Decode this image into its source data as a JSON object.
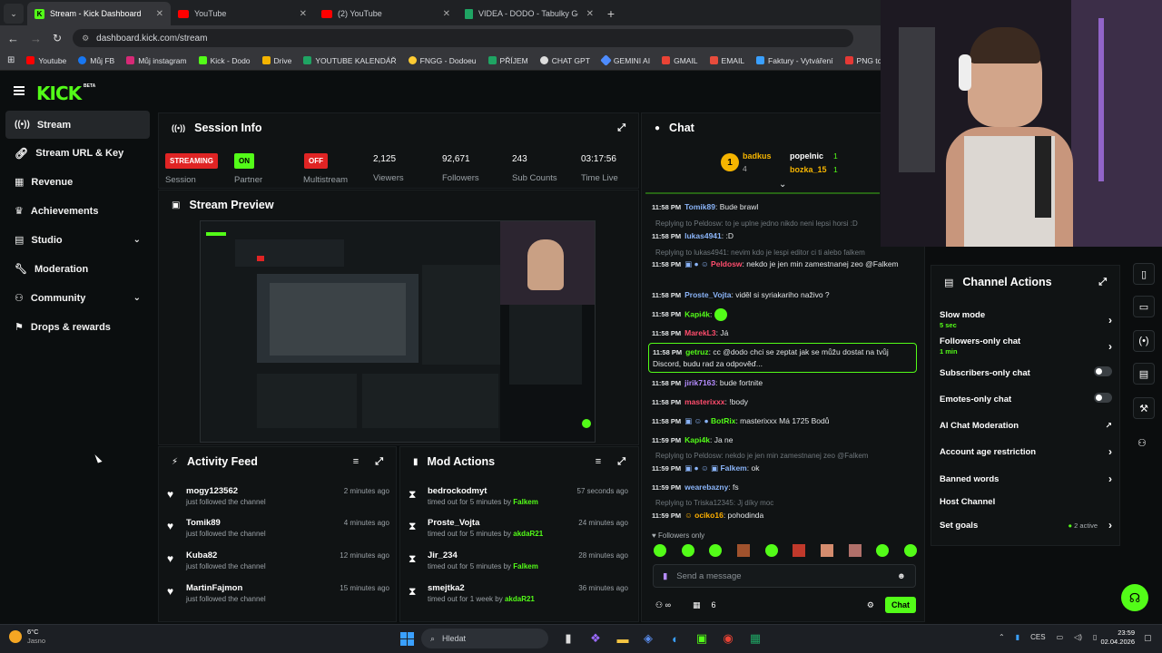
{
  "browser": {
    "tabs": [
      {
        "title": "Stream - Kick Dashboard",
        "icon": "kick-icon",
        "color": "#53fc18"
      },
      {
        "title": "YouTube",
        "icon": "youtube-icon",
        "color": "#ff0000"
      },
      {
        "title": "(2) YouTube",
        "icon": "youtube-icon",
        "color": "#ff0000"
      },
      {
        "title": "VIDEA - DODO - Tabulky Googl",
        "icon": "sheets-icon",
        "color": "#1fa463"
      }
    ],
    "url": "dashboard.kick.com/stream",
    "bookmarks": [
      "Youtube",
      "Můj FB",
      "Můj instagram",
      "Kick - Dodo",
      "Drive",
      "YOUTUBE KALENDÁŘ",
      "FNGG - Dodoeu",
      "PŘÍJEM",
      "CHAT GPT",
      "GEMINI AI",
      "GMAIL",
      "EMAIL",
      "Faktury - Vytváření",
      "PNG to PDF"
    ]
  },
  "brand": {
    "logo": "KICK",
    "beta": "BETA",
    "accent": "#53fc18"
  },
  "sidebar": {
    "items": [
      {
        "label": "Stream",
        "icon": "broadcast-icon"
      },
      {
        "label": "Stream URL & Key",
        "icon": "link-icon"
      },
      {
        "label": "Revenue",
        "icon": "revenue-icon"
      },
      {
        "label": "Achievements",
        "icon": "trophy-icon"
      },
      {
        "label": "Studio",
        "icon": "studio-icon"
      },
      {
        "label": "Moderation",
        "icon": "wrench-icon"
      },
      {
        "label": "Community",
        "icon": "community-icon"
      },
      {
        "label": "Drops & rewards",
        "icon": "gift-icon"
      }
    ]
  },
  "session": {
    "title": "Session Info",
    "streaming_badge": "STREAMING",
    "session_label": "Session",
    "partner_badge": "ON",
    "partner_label": "Partner",
    "multistream_badge": "OFF",
    "multistream_label": "Multistream",
    "viewers": "2,125",
    "viewers_label": "Viewers",
    "followers": "92,671",
    "followers_label": "Followers",
    "subs": "243",
    "subs_label": "Sub Counts",
    "time": "03:17:56",
    "time_label": "Time Live"
  },
  "preview": {
    "title": "Stream Preview"
  },
  "activity": {
    "title": "Activity Feed",
    "items": [
      {
        "name": "mogy123562",
        "action": "just followed the channel",
        "time": "2 minutes ago"
      },
      {
        "name": "Tomik89",
        "action": "just followed the channel",
        "time": "4 minutes ago"
      },
      {
        "name": "Kuba82",
        "action": "just followed the channel",
        "time": "12 minutes ago"
      },
      {
        "name": "MartinFajmon",
        "action": "just followed the channel",
        "time": "15 minutes ago"
      }
    ]
  },
  "mod": {
    "title": "Mod Actions",
    "items": [
      {
        "name": "bedrockodmyt",
        "action": "timed out for 5 minutes by",
        "by": "Falkem",
        "time": "57 seconds ago"
      },
      {
        "name": "Proste_Vojta",
        "action": "timed out for 5 minutes by",
        "by": "akdaR21",
        "time": "24 minutes ago"
      },
      {
        "name": "Jir_234",
        "action": "timed out for 5 minutes by",
        "by": "Falkem",
        "time": "28 minutes ago"
      },
      {
        "name": "smejtka2",
        "action": "timed out for 1 week by",
        "by": "akdaR21",
        "time": "36 minutes ago"
      }
    ]
  },
  "chat": {
    "title": "Chat",
    "leaderboard": [
      {
        "rank": "1",
        "name": "badkus",
        "count": "4"
      },
      {
        "name": "popelnic",
        "count": "1"
      },
      {
        "name": "bozka_15",
        "count": "1"
      }
    ],
    "messages": [
      {
        "time": "11:58 PM",
        "user": "Tomik89",
        "color": "#8ab4f8",
        "text": "Bude brawl"
      },
      {
        "reply": "Replying to Peldosw: to je uplne jedno nikdo neni lepsi horsi :D"
      },
      {
        "time": "11:58 PM",
        "user": "lukas4941",
        "color": "#8ab4f8",
        "text": ":D"
      },
      {
        "reply": "Replying to lukas4941: nevim kdo je lespi editor ci ti alebo falkem"
      },
      {
        "time": "11:58 PM",
        "user": "Peldosw",
        "color": "#ff4d6d",
        "text": "nekdo je jen min zamestnanej zeo @Falkem"
      },
      {
        "time": "11:58 PM",
        "user": "Proste_Vojta",
        "color": "#8ab4f8",
        "text": "viděl si syriakariho naživo ?"
      },
      {
        "time": "11:58 PM",
        "user": "Kapi4k",
        "color": "#53fc18",
        "text": ""
      },
      {
        "time": "11:58 PM",
        "user": "MarekL3",
        "color": "#ff4d6d",
        "text": "Já"
      },
      {
        "time": "11:58 PM",
        "user": "getruz",
        "color": "#53fc18",
        "text": "cc @dodo chci se zeptat jak se můžu dostat na tvůj Discord, budu rad za odpověď..."
      },
      {
        "time": "11:58 PM",
        "user": "jirik7163",
        "color": "#b58cff",
        "text": "bude fortnite"
      },
      {
        "time": "11:58 PM",
        "user": "masterixxx",
        "color": "#ff4d6d",
        "text": "!body"
      },
      {
        "time": "11:58 PM",
        "user": "BotRix",
        "color": "#53fc18",
        "text": "masterixxx Má 1725 Bodů"
      },
      {
        "time": "11:59 PM",
        "user": "Kapi4k",
        "color": "#53fc18",
        "text": "Ja ne"
      },
      {
        "reply": "Replying to Peldosw: nekdo je jen min zamestnanej zeo @Falkem"
      },
      {
        "time": "11:59 PM",
        "user": "Falkem",
        "color": "#8ab4f8",
        "text": "ok"
      },
      {
        "time": "11:59 PM",
        "user": "wearebazny",
        "color": "#8ab4f8",
        "text": "fs"
      },
      {
        "reply": "Replying to Triska12345: Jj díky moc"
      },
      {
        "time": "11:59 PM",
        "user": "ociko16",
        "color": "#ffb000",
        "text": "pohodinda"
      }
    ],
    "followers_only": "Followers only",
    "placeholder": "Send a message",
    "viewers_count": "6",
    "send_label": "Chat"
  },
  "channel_actions": {
    "title": "Channel Actions",
    "items": [
      {
        "label": "Slow mode",
        "sub": "5 sec",
        "control": "arrow"
      },
      {
        "label": "Followers-only chat",
        "sub": "1 min",
        "control": "arrow"
      },
      {
        "label": "Subscribers-only chat",
        "sub": "",
        "control": "toggle"
      },
      {
        "label": "Emotes-only chat",
        "sub": "",
        "control": "toggle"
      },
      {
        "label": "AI Chat Moderation",
        "sub": "",
        "control": "external"
      },
      {
        "label": "Account age restriction",
        "sub": "",
        "control": "arrow"
      },
      {
        "label": "Banned words",
        "sub": "",
        "control": "arrow"
      },
      {
        "label": "Host Channel",
        "sub": "",
        "control": "none"
      },
      {
        "label": "Set goals",
        "sub": "",
        "control": "arrow",
        "extra": "2 active"
      }
    ]
  },
  "taskbar": {
    "weather_temp": "6°C",
    "weather_desc": "Jasno",
    "search_placeholder": "Hledat",
    "lang": "CES",
    "time": "23:59",
    "date": "02.04.2026"
  }
}
